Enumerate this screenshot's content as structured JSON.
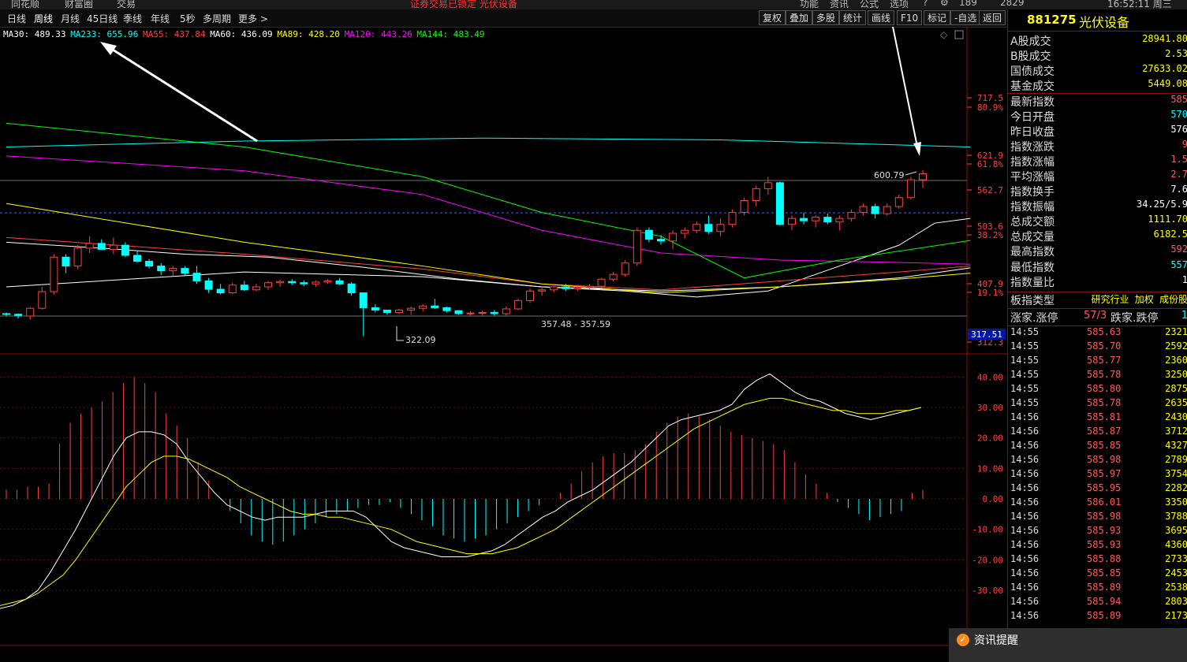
{
  "topbar": {
    "items": [
      "同花顺",
      "财富圈",
      "交易",
      "证券交易已锁定  光伏设备",
      "功能",
      "资讯",
      "公式",
      "选项",
      "189",
      "2829",
      "16:52:11 周三"
    ],
    "highlight_color": "#ff3030"
  },
  "periods": {
    "tabs": [
      "日线",
      "周线",
      "月线",
      "45日线",
      "季线",
      "年线",
      "5秒",
      "多周期",
      "更多 >"
    ],
    "active": "周线"
  },
  "toolbar": {
    "buttons": [
      "复权",
      "叠加",
      "多股",
      "统计",
      "画线",
      "F10",
      "标记",
      "-自选",
      "返回"
    ]
  },
  "ma_legend": [
    {
      "label": "MA30: 489.33",
      "color": "#ffffff"
    },
    {
      "label": "MA233: 655.96",
      "color": "#00ffff"
    },
    {
      "label": "MA55: 437.84",
      "color": "#ff4040"
    },
    {
      "label": "MA60: 436.09",
      "color": "#ffffff"
    },
    {
      "label": "MA89: 428.20",
      "color": "#ffff00"
    },
    {
      "label": "MA120: 443.26",
      "color": "#ff00ff"
    },
    {
      "label": "MA144: 483.49",
      "color": "#00ff00"
    }
  ],
  "axis": {
    "price_ticks": [
      "717.5",
      "80.9%",
      "621.9",
      "61.8%",
      "562.7",
      "503.6",
      "38.2%",
      "407.9",
      "19.1%",
      "312.3"
    ],
    "current_tag": "317.51",
    "macd_ticks": [
      "40.00",
      "30.00",
      "20.00",
      "10.00",
      "0.00",
      "-10.00",
      "-20.00",
      "-30.00"
    ]
  },
  "chart_data": {
    "type": "candlestick",
    "price_ylim": [
      312.3,
      717.5
    ],
    "macd_ylim": [
      -30,
      40
    ],
    "annotations": [
      "600.79",
      "322.09",
      "357.48 - 357.59"
    ],
    "candles": [
      [
        360,
        362,
        356,
        359
      ],
      [
        359,
        360,
        352,
        357
      ],
      [
        356,
        371,
        350,
        369
      ],
      [
        369,
        405,
        367,
        397
      ],
      [
        397,
        460,
        392,
        455
      ],
      [
        455,
        460,
        428,
        440
      ],
      [
        440,
        475,
        435,
        470
      ],
      [
        470,
        490,
        462,
        478
      ],
      [
        478,
        485,
        470,
        468
      ],
      [
        468,
        488,
        460,
        475
      ],
      [
        475,
        480,
        455,
        458
      ],
      [
        458,
        465,
        445,
        448
      ],
      [
        448,
        452,
        436,
        440
      ],
      [
        440,
        445,
        425,
        432
      ],
      [
        432,
        440,
        424,
        436
      ],
      [
        436,
        440,
        424,
        428
      ],
      [
        428,
        440,
        410,
        415
      ],
      [
        415,
        420,
        395,
        401
      ],
      [
        401,
        410,
        392,
        395
      ],
      [
        395,
        412,
        393,
        408
      ],
      [
        408,
        415,
        398,
        400
      ],
      [
        400,
        410,
        398,
        405
      ],
      [
        405,
        415,
        400,
        412
      ],
      [
        412,
        417,
        405,
        414
      ],
      [
        414,
        418,
        408,
        412
      ],
      [
        412,
        416,
        406,
        410
      ],
      [
        410,
        416,
        405,
        413
      ],
      [
        413,
        418,
        410,
        415
      ],
      [
        415,
        420,
        408,
        410
      ],
      [
        410,
        413,
        390,
        395
      ],
      [
        395,
        380,
        322,
        370
      ],
      [
        370,
        376,
        362,
        366
      ],
      [
        366,
        366,
        358,
        362
      ],
      [
        362,
        368,
        360,
        366
      ],
      [
        366,
        372,
        358,
        369
      ],
      [
        369,
        376,
        364,
        373
      ],
      [
        373,
        385,
        368,
        370
      ],
      [
        370,
        372,
        362,
        365
      ],
      [
        365,
        366,
        358,
        360
      ],
      [
        360,
        364,
        357,
        361
      ],
      [
        361,
        365,
        357,
        362
      ],
      [
        362,
        366,
        357,
        360
      ],
      [
        360,
        372,
        357,
        368
      ],
      [
        368,
        385,
        366,
        382
      ],
      [
        382,
        402,
        378,
        398
      ],
      [
        398,
        405,
        390,
        400
      ],
      [
        400,
        410,
        396,
        405
      ],
      [
        405,
        410,
        398,
        402
      ],
      [
        402,
        408,
        398,
        404
      ],
      [
        404,
        410,
        400,
        406
      ],
      [
        406,
        420,
        404,
        418
      ],
      [
        418,
        430,
        414,
        426
      ],
      [
        426,
        450,
        422,
        445
      ],
      [
        445,
        505,
        440,
        500
      ],
      [
        500,
        505,
        480,
        485
      ],
      [
        485,
        492,
        476,
        482
      ],
      [
        482,
        500,
        468,
        495
      ],
      [
        495,
        505,
        486,
        500
      ],
      [
        500,
        515,
        495,
        510
      ],
      [
        510,
        525,
        494,
        498
      ],
      [
        498,
        520,
        490,
        510
      ],
      [
        510,
        535,
        505,
        530
      ],
      [
        530,
        555,
        525,
        550
      ],
      [
        550,
        575,
        540,
        570
      ],
      [
        570,
        590,
        560,
        580
      ],
      [
        580,
        582,
        508,
        510
      ],
      [
        510,
        525,
        500,
        520
      ],
      [
        520,
        530,
        510,
        516
      ],
      [
        516,
        525,
        505,
        522
      ],
      [
        522,
        528,
        510,
        514
      ],
      [
        514,
        525,
        500,
        520
      ],
      [
        520,
        535,
        515,
        530
      ],
      [
        530,
        545,
        525,
        540
      ],
      [
        540,
        545,
        520,
        528
      ],
      [
        528,
        545,
        525,
        540
      ],
      [
        540,
        560,
        536,
        555
      ],
      [
        555,
        590,
        552,
        585
      ],
      [
        585,
        601,
        571,
        595
      ]
    ],
    "ma_lines": [
      {
        "name": "MA30",
        "color": "#ffffff",
        "points": [
          [
            0,
            480
          ],
          [
            8,
            470
          ],
          [
            15,
            460
          ],
          [
            22,
            455
          ],
          [
            30,
            438
          ],
          [
            38,
            418
          ],
          [
            45,
            405
          ],
          [
            52,
            398
          ],
          [
            58,
            388
          ],
          [
            64,
            398
          ],
          [
            70,
            440
          ],
          [
            75,
            475
          ],
          [
            78,
            512
          ],
          [
            81,
            520
          ]
        ]
      },
      {
        "name": "MA233",
        "color": "#00ffff",
        "points": [
          [
            0,
            640
          ],
          [
            20,
            650
          ],
          [
            40,
            655
          ],
          [
            60,
            652
          ],
          [
            81,
            640
          ]
        ]
      },
      {
        "name": "MA55",
        "color": "#ff4040",
        "points": [
          [
            0,
            488
          ],
          [
            20,
            460
          ],
          [
            35,
            435
          ],
          [
            45,
            410
          ],
          [
            55,
            400
          ],
          [
            65,
            415
          ],
          [
            75,
            430
          ],
          [
            81,
            440
          ]
        ]
      },
      {
        "name": "MA60",
        "color": "#ffffff",
        "points": [
          [
            0,
            405
          ],
          [
            20,
            430
          ],
          [
            35,
            422
          ],
          [
            45,
            405
          ],
          [
            55,
            398
          ],
          [
            65,
            405
          ],
          [
            75,
            420
          ],
          [
            81,
            437
          ]
        ]
      },
      {
        "name": "MA89",
        "color": "#ffff00",
        "points": [
          [
            0,
            545
          ],
          [
            20,
            480
          ],
          [
            35,
            440
          ],
          [
            45,
            410
          ],
          [
            55,
            395
          ],
          [
            65,
            405
          ],
          [
            75,
            418
          ],
          [
            81,
            428
          ]
        ]
      },
      {
        "name": "MA120",
        "color": "#ff00ff",
        "points": [
          [
            0,
            625
          ],
          [
            20,
            600
          ],
          [
            35,
            560
          ],
          [
            45,
            500
          ],
          [
            55,
            462
          ],
          [
            65,
            450
          ],
          [
            75,
            446
          ],
          [
            81,
            443
          ]
        ]
      },
      {
        "name": "MA144",
        "color": "#00ff00",
        "points": [
          [
            0,
            680
          ],
          [
            20,
            640
          ],
          [
            35,
            590
          ],
          [
            45,
            530
          ],
          [
            55,
            490
          ],
          [
            62,
            420
          ],
          [
            70,
            450
          ],
          [
            81,
            483
          ]
        ]
      }
    ],
    "macd_hist": [
      3,
      3,
      4,
      4,
      5,
      18,
      25,
      28,
      30,
      32,
      35,
      38,
      40,
      38,
      35,
      28,
      24,
      20,
      12,
      6,
      0,
      -4,
      -8,
      -12,
      -14,
      -15,
      -14,
      -12,
      -10,
      -8,
      -6,
      -5,
      -4,
      -3,
      -2,
      -2,
      -1,
      -3,
      -5,
      -7,
      -9,
      -12,
      -13,
      -14,
      -13,
      -12,
      -10,
      -8,
      -6,
      -4,
      -2,
      0,
      2,
      5,
      9,
      12,
      14,
      15,
      15,
      16,
      18,
      22,
      25,
      27,
      28,
      27,
      26,
      24,
      22,
      21,
      20,
      19,
      18,
      16,
      12,
      8,
      5,
      2,
      -1,
      -3,
      -5,
      -7,
      -6,
      -5,
      -4,
      2,
      3
    ],
    "dif": [
      -36,
      -35,
      -33,
      -30,
      -24,
      -17,
      -10,
      -2,
      6,
      14,
      20,
      22,
      22,
      21,
      18,
      12,
      7,
      2,
      -2,
      -4,
      -6,
      -7,
      -6,
      -6,
      -6,
      -5,
      -4,
      -4,
      -4,
      -6,
      -10,
      -14,
      -16,
      -17,
      -18,
      -19,
      -19,
      -19,
      -18,
      -17,
      -15,
      -12,
      -9,
      -6,
      -4,
      -1,
      1,
      3,
      6,
      9,
      12,
      16,
      20,
      24,
      26,
      27,
      28,
      29,
      31,
      36,
      39,
      41,
      38,
      35,
      33,
      32,
      30,
      28,
      27,
      26,
      27,
      28,
      29,
      30
    ],
    "dea": [
      -35,
      -34,
      -33,
      -31,
      -28,
      -25,
      -20,
      -14,
      -8,
      -2,
      4,
      8,
      12,
      14,
      14,
      13,
      11,
      9,
      7,
      4,
      2,
      0,
      -2,
      -4,
      -5,
      -5,
      -6,
      -6,
      -7,
      -8,
      -9,
      -10,
      -12,
      -14,
      -15,
      -16,
      -17,
      -18,
      -18,
      -18,
      -17,
      -16,
      -14,
      -12,
      -10,
      -7,
      -4,
      -1,
      2,
      5,
      8,
      11,
      14,
      17,
      20,
      23,
      25,
      27,
      29,
      31,
      32,
      33,
      33,
      32,
      31,
      30,
      29,
      29,
      28,
      28,
      28,
      29,
      29,
      30
    ]
  },
  "right_panel": {
    "code": "881275",
    "name": "光伏设备",
    "rows": [
      {
        "k": "A股成交",
        "v": "28941.80",
        "c": "#ffff00"
      },
      {
        "k": "B股成交",
        "v": "2.53",
        "c": "#ffff00"
      },
      {
        "k": "国债成交",
        "v": "27633.02",
        "c": "#ffff00"
      },
      {
        "k": "基金成交",
        "v": "5449.08",
        "c": "#ffff00"
      },
      {
        "k": "最新指数",
        "v": "585",
        "c": "#ff5a5a"
      },
      {
        "k": "今日开盘",
        "v": "570",
        "c": "#00ffff"
      },
      {
        "k": "昨日收盘",
        "v": "576",
        "c": "#ffffff"
      },
      {
        "k": "指数涨跌",
        "v": "9",
        "c": "#ff5a5a"
      },
      {
        "k": "指数涨幅",
        "v": "1.5",
        "c": "#ff5a5a"
      },
      {
        "k": "平均涨幅",
        "v": "2.7",
        "c": "#ff5a5a"
      },
      {
        "k": "指数换手",
        "v": "7.6",
        "c": "#ffffff"
      },
      {
        "k": "指数振幅",
        "v": "34.25/5.9",
        "c": "#ffffff"
      },
      {
        "k": "总成交额",
        "v": "1111.70",
        "c": "#ffff00"
      },
      {
        "k": "总成交量",
        "v": "6182.5",
        "c": "#ffff00"
      },
      {
        "k": "最高指数",
        "v": "592",
        "c": "#ff5a5a"
      },
      {
        "k": "最低指数",
        "v": "557",
        "c": "#00ffff"
      },
      {
        "k": "指数量比",
        "v": "1",
        "c": "#ffffff"
      }
    ],
    "board_type_label": "板指类型",
    "board_type_value": "研究行业 加权 成份股",
    "updown": {
      "up_label": "涨家.涨停",
      "up_value": "57/3",
      "down_label": "跌家.跌停",
      "down_value": "1"
    },
    "ticks": [
      {
        "t": "14:55",
        "p": "585.63",
        "q": "2321"
      },
      {
        "t": "14:55",
        "p": "585.70",
        "q": "2592"
      },
      {
        "t": "14:55",
        "p": "585.77",
        "q": "2360"
      },
      {
        "t": "14:55",
        "p": "585.78",
        "q": "3250"
      },
      {
        "t": "14:55",
        "p": "585.80",
        "q": "2875"
      },
      {
        "t": "14:55",
        "p": "585.78",
        "q": "2635"
      },
      {
        "t": "14:56",
        "p": "585.81",
        "q": "2430"
      },
      {
        "t": "14:56",
        "p": "585.87",
        "q": "3712"
      },
      {
        "t": "14:56",
        "p": "585.85",
        "q": "4327"
      },
      {
        "t": "14:56",
        "p": "585.98",
        "q": "2789"
      },
      {
        "t": "14:56",
        "p": "585.97",
        "q": "3754"
      },
      {
        "t": "14:56",
        "p": "585.95",
        "q": "2282"
      },
      {
        "t": "14:56",
        "p": "586.01",
        "q": "3350"
      },
      {
        "t": "14:56",
        "p": "585.98",
        "q": "3788"
      },
      {
        "t": "14:56",
        "p": "585.93",
        "q": "3695"
      },
      {
        "t": "14:56",
        "p": "585.93",
        "q": "4360"
      },
      {
        "t": "14:56",
        "p": "585.88",
        "q": "2733"
      },
      {
        "t": "14:56",
        "p": "585.85",
        "q": "2453"
      },
      {
        "t": "14:56",
        "p": "585.89",
        "q": "2538"
      },
      {
        "t": "14:56",
        "p": "585.94",
        "q": "2803"
      },
      {
        "t": "14:56",
        "p": "585.89",
        "q": "2173"
      }
    ]
  },
  "popup": {
    "label": "资讯提醒"
  }
}
